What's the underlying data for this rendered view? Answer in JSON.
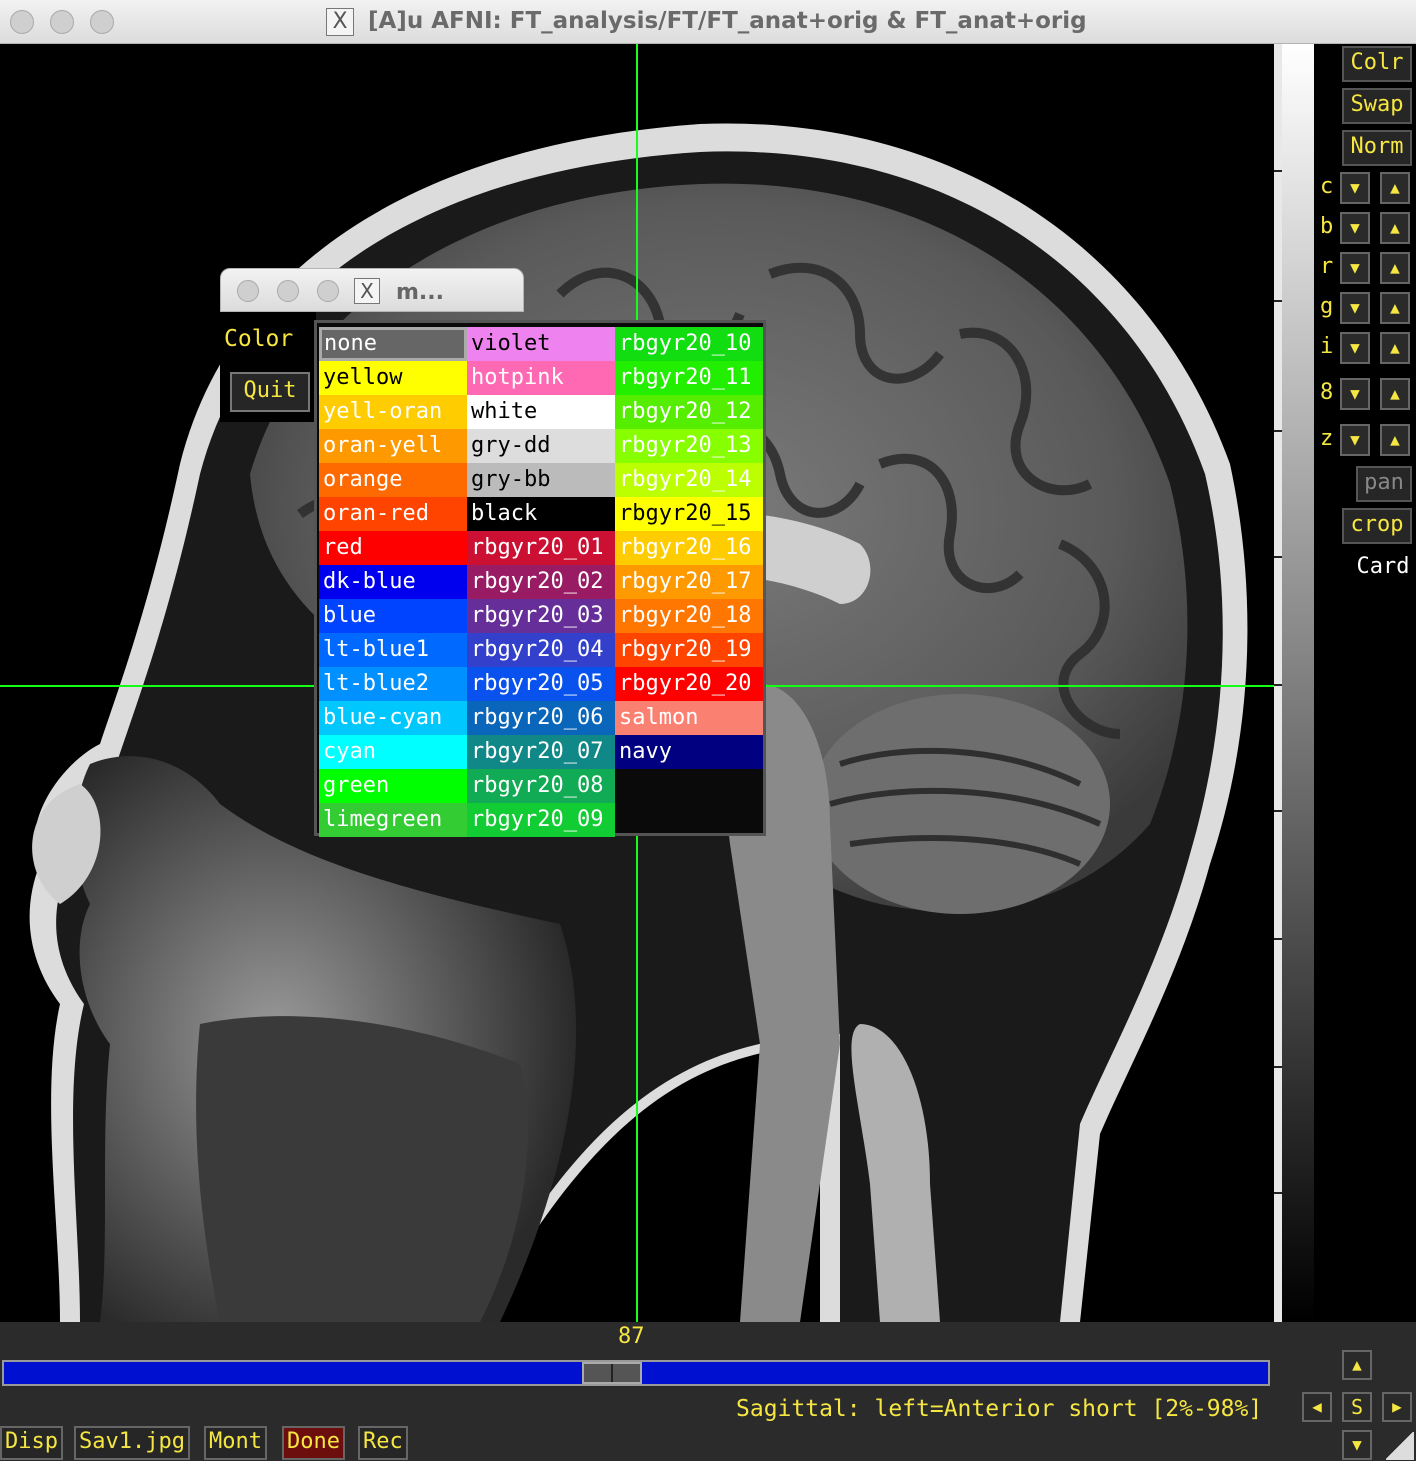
{
  "window": {
    "title": "[A]u AFNI: FT_analysis/FT/FT_anat+orig & FT_anat+orig",
    "x_logo": "X"
  },
  "popup": {
    "title": "m...",
    "x_logo": "X",
    "label": "Color",
    "quit_label": "Quit"
  },
  "color_menu": {
    "columns": [
      [
        {
          "label": "none",
          "bg": "#666666",
          "fg": "#ffffff",
          "selected": true
        },
        {
          "label": "yellow",
          "bg": "#ffff00",
          "fg": "#000000"
        },
        {
          "label": "yell-oran",
          "bg": "#ffcc00",
          "fg": "#ffffff"
        },
        {
          "label": "oran-yell",
          "bg": "#ff9900",
          "fg": "#ffffff"
        },
        {
          "label": "orange",
          "bg": "#ff6a00",
          "fg": "#ffffff"
        },
        {
          "label": "oran-red",
          "bg": "#ff4400",
          "fg": "#ffffff"
        },
        {
          "label": "red",
          "bg": "#ff0000",
          "fg": "#ffffff"
        },
        {
          "label": "dk-blue",
          "bg": "#0000ee",
          "fg": "#ffffff"
        },
        {
          "label": "blue",
          "bg": "#0044ff",
          "fg": "#ffffff"
        },
        {
          "label": "lt-blue1",
          "bg": "#0069ff",
          "fg": "#ffffff"
        },
        {
          "label": "lt-blue2",
          "bg": "#0090ff",
          "fg": "#ffffff"
        },
        {
          "label": "blue-cyan",
          "bg": "#00c8ff",
          "fg": "#ffffff"
        },
        {
          "label": "cyan",
          "bg": "#00ffff",
          "fg": "#ffffff"
        },
        {
          "label": "green",
          "bg": "#00ff00",
          "fg": "#ffffff"
        },
        {
          "label": "limegreen",
          "bg": "#33cc33",
          "fg": "#ffffff"
        }
      ],
      [
        {
          "label": "violet",
          "bg": "#ee82ee",
          "fg": "#000000"
        },
        {
          "label": "hotpink",
          "bg": "#ff69b4",
          "fg": "#ffffff"
        },
        {
          "label": "white",
          "bg": "#ffffff",
          "fg": "#000000"
        },
        {
          "label": "gry-dd",
          "bg": "#dddddd",
          "fg": "#000000"
        },
        {
          "label": "gry-bb",
          "bg": "#bbbbbb",
          "fg": "#000000"
        },
        {
          "label": "black",
          "bg": "#000000",
          "fg": "#ffffff"
        },
        {
          "label": "rbgyr20_01",
          "bg": "#cc1033",
          "fg": "#ffffff"
        },
        {
          "label": "rbgyr20_02",
          "bg": "#991b63",
          "fg": "#ffffff"
        },
        {
          "label": "rbgyr20_03",
          "bg": "#662e99",
          "fg": "#ffffff"
        },
        {
          "label": "rbgyr20_04",
          "bg": "#3340cc",
          "fg": "#ffffff"
        },
        {
          "label": "rbgyr20_05",
          "bg": "#0a52ee",
          "fg": "#ffffff"
        },
        {
          "label": "rbgyr20_06",
          "bg": "#0a66bb",
          "fg": "#ffffff"
        },
        {
          "label": "rbgyr20_07",
          "bg": "#118888",
          "fg": "#ffffff"
        },
        {
          "label": "rbgyr20_08",
          "bg": "#11aa55",
          "fg": "#ffffff"
        },
        {
          "label": "rbgyr20_09",
          "bg": "#11cc33",
          "fg": "#ffffff"
        }
      ],
      [
        {
          "label": "rbgyr20_10",
          "bg": "#11dd11",
          "fg": "#ffffff"
        },
        {
          "label": "rbgyr20_11",
          "bg": "#22ee00",
          "fg": "#ffffff"
        },
        {
          "label": "rbgyr20_12",
          "bg": "#55ee00",
          "fg": "#ffffff"
        },
        {
          "label": "rbgyr20_13",
          "bg": "#88ff00",
          "fg": "#ffffff"
        },
        {
          "label": "rbgyr20_14",
          "bg": "#bbff00",
          "fg": "#ffffff"
        },
        {
          "label": "rbgyr20_15",
          "bg": "#ffff00",
          "fg": "#000000"
        },
        {
          "label": "rbgyr20_16",
          "bg": "#ffcc00",
          "fg": "#ffffff"
        },
        {
          "label": "rbgyr20_17",
          "bg": "#ff9900",
          "fg": "#ffffff"
        },
        {
          "label": "rbgyr20_18",
          "bg": "#ff7700",
          "fg": "#ffffff"
        },
        {
          "label": "rbgyr20_19",
          "bg": "#ff4400",
          "fg": "#ffffff"
        },
        {
          "label": "rbgyr20_20",
          "bg": "#ff0000",
          "fg": "#ffffff"
        },
        {
          "label": "salmon",
          "bg": "#fa8072",
          "fg": "#ffffff"
        },
        {
          "label": "navy",
          "bg": "#000080",
          "fg": "#ffffff"
        }
      ]
    ]
  },
  "right_panel": {
    "top_buttons": [
      "Colr",
      "Swap",
      "Norm"
    ],
    "arrow_rows": [
      "c",
      "b",
      "r",
      "g",
      "i",
      "8",
      "z"
    ],
    "pan_label": "pan",
    "crop_label": "crop",
    "card_label": "Card"
  },
  "bottom": {
    "slice_number": "87",
    "slider_position": 0.48,
    "status": "Sagittal: left=Anterior short [2%-98%]",
    "buttons": [
      "Disp",
      "Sav1.jpg",
      "Mont",
      "Done",
      "Rec"
    ],
    "nav_center_label": "S"
  },
  "colors": {
    "accent_text": "#f5e642",
    "crosshair": "#14ff14",
    "slider": "#0010d0"
  }
}
